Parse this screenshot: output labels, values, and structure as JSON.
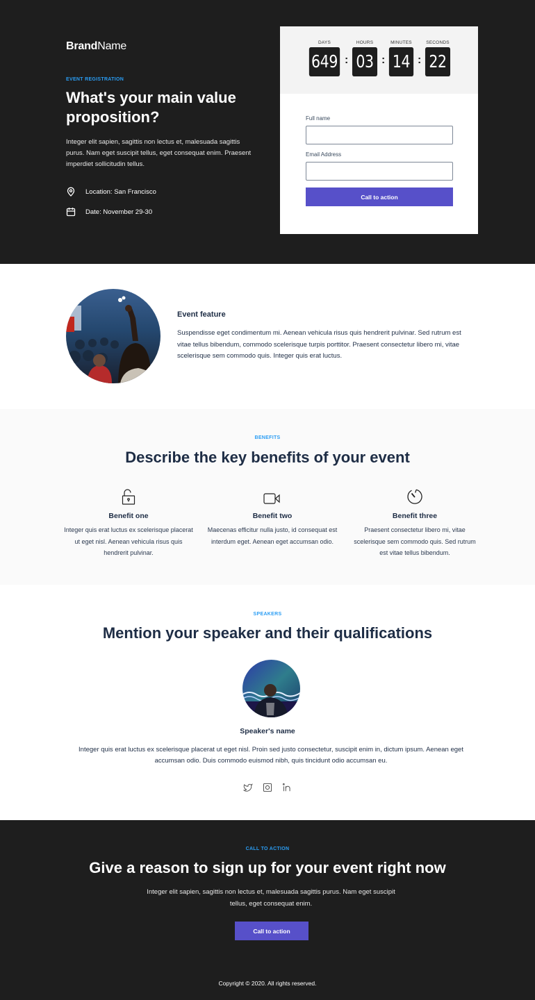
{
  "brand": {
    "bold": "Brand",
    "light": "Name"
  },
  "hero": {
    "eyebrow": "EVENT REGISTRATION",
    "title": "What's your main value proposition?",
    "text": "Integer elit sapien, sagittis non lectus et, malesuada sagittis purus. Nam eget suscipit tellus, eget consequat enim. Praesent imperdiet sollicitudin tellus.",
    "location": {
      "icon": "map-pin-icon",
      "label": "Location: San Francisco"
    },
    "date": {
      "icon": "calendar-icon",
      "label": "Date: November 29-30"
    }
  },
  "countdown": {
    "units": [
      {
        "label": "DAYS",
        "value": "649"
      },
      {
        "label": "HOURS",
        "value": "03"
      },
      {
        "label": "MINUTES",
        "value": "14"
      },
      {
        "label": "SECONDS",
        "value": "22"
      }
    ],
    "separator": ":"
  },
  "form": {
    "fields": [
      {
        "label": "Full name",
        "value": "",
        "placeholder": ""
      },
      {
        "label": "Email Address",
        "value": "",
        "placeholder": ""
      }
    ],
    "submit_label": "Call to action",
    "accent_color": "#5750c9"
  },
  "feature": {
    "image": "audience-photo",
    "title": "Event feature",
    "text": "Suspendisse eget condimentum mi. Aenean vehicula risus quis hendrerit pulvinar. Sed rutrum est vitae tellus bibendum, commodo scelerisque turpis porttitor. Praesent consectetur libero mi, vitae scelerisque sem commodo quis. Integer quis erat luctus."
  },
  "benefits": {
    "eyebrow": "BENEFITS",
    "title": "Describe the key benefits of your event",
    "items": [
      {
        "icon": "unlock-icon",
        "title": "Benefit one",
        "text": "Integer quis erat luctus ex scelerisque placerat ut eget nisl. Aenean vehicula risus quis hendrerit pulvinar."
      },
      {
        "icon": "video-camera-icon",
        "title": "Benefit two",
        "text": "Maecenas efficitur nulla justo, id consequat est interdum eget. Aenean eget accumsan odio."
      },
      {
        "icon": "timer-icon",
        "title": "Benefit three",
        "text": "Praesent consectetur libero mi, vitae scelerisque sem commodo quis. Sed rutrum est vitae tellus bibendum."
      }
    ]
  },
  "speakers": {
    "eyebrow": "SPEAKERS",
    "title": "Mention your speaker and their qualifications",
    "image": "speaker-photo",
    "name": "Speaker's name",
    "bio": "Integer quis erat luctus ex scelerisque placerat ut eget nisl. Proin sed justo consectetur, suscipit enim in, dictum ipsum. Aenean eget accumsan odio. Duis commodo euismod nibh, quis tincidunt odio accumsan eu.",
    "socials": [
      "twitter-icon",
      "instagram-icon",
      "linkedin-icon"
    ]
  },
  "cta": {
    "eyebrow": "CALL TO ACTION",
    "title": "Give a reason to sign up for your event right now",
    "text": "Integer elit sapien, sagittis non lectus et, malesuada sagittis purus. Nam eget suscipit tellus, eget consequat enim.",
    "button_label": "Call to action"
  },
  "footer": {
    "copyright": "Copyright © 2020. All rights reserved."
  },
  "colors": {
    "dark_bg": "#1e1e1e",
    "eyebrow": "#2a9df4",
    "heading": "#1e2d45",
    "accent": "#5750c9",
    "light_bg": "#fafafa"
  }
}
